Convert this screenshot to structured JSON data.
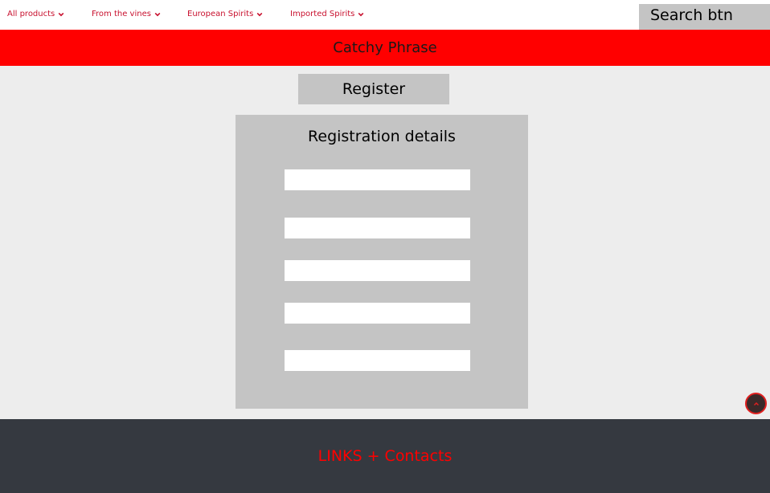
{
  "nav": {
    "items": [
      {
        "label": "All products"
      },
      {
        "label": "From the vines"
      },
      {
        "label": "European Spirits"
      },
      {
        "label": "Imported Spirits"
      }
    ],
    "search_label": "Search btn"
  },
  "banner": {
    "text": "Catchy Phrase"
  },
  "register": {
    "label": "Register"
  },
  "form": {
    "title": "Registration details",
    "fields": [
      "",
      "",
      "",
      "",
      ""
    ]
  },
  "footer": {
    "text": "LINKS + Contacts"
  },
  "colors": {
    "accent": "#ff0000",
    "nav_text": "#c8102e",
    "footer_bg": "#353940",
    "panel_bg": "#c4c4c4",
    "page_bg": "#ededed"
  },
  "icons": {
    "dropdown": "chevron-down-icon",
    "scroll_top": "chevron-up-icon"
  }
}
